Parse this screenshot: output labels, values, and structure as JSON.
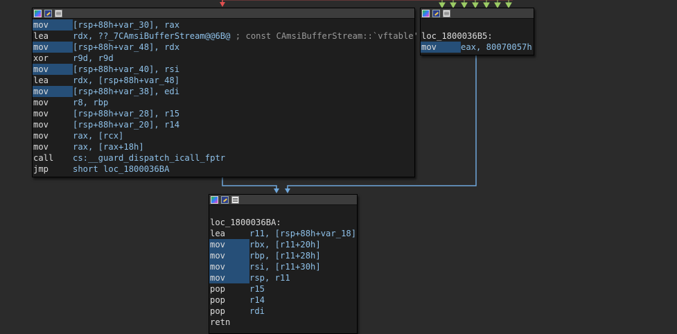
{
  "blocks": {
    "main": {
      "lines": [
        {
          "mnem": "mov",
          "ops": "[rsp+88h+var_30], rax",
          "hl": true
        },
        {
          "mnem": "lea",
          "ops": "rdx, ??_7CAmsiBufferStream@@6B@",
          "comment": " ; const CAmsiBufferStream::`vftable'",
          "hl": false
        },
        {
          "mnem": "mov",
          "ops": "[rsp+88h+var_48], rdx",
          "hl": true
        },
        {
          "mnem": "xor",
          "ops": "r9d, r9d",
          "hl": false
        },
        {
          "mnem": "mov",
          "ops": "[rsp+88h+var_40], rsi",
          "hl": true
        },
        {
          "mnem": "lea",
          "ops": "rdx, [rsp+88h+var_48]",
          "hl": false
        },
        {
          "mnem": "mov",
          "ops": "[rsp+88h+var_38], edi",
          "hl": true
        },
        {
          "mnem": "mov",
          "ops": "r8, rbp",
          "hl": false
        },
        {
          "mnem": "mov",
          "ops": "[rsp+88h+var_28], r15",
          "hl": false
        },
        {
          "mnem": "mov",
          "ops": "[rsp+88h+var_20], r14",
          "hl": false
        },
        {
          "mnem": "mov",
          "ops": "rax, [rcx]",
          "hl": false
        },
        {
          "mnem": "mov",
          "ops": "rax, [rax+18h]",
          "hl": false
        },
        {
          "mnem": "call",
          "ops": "cs:__guard_dispatch_icall_fptr",
          "hl": false
        },
        {
          "mnem": "jmp",
          "ops": "short loc_1800036BA",
          "hl": false
        }
      ]
    },
    "right": {
      "label": "loc_1800036B5:",
      "lines": [
        {
          "mnem": "mov",
          "ops": "eax, 80070057h",
          "hl": true
        }
      ]
    },
    "bottom": {
      "label": "loc_1800036BA:",
      "lines": [
        {
          "mnem": "lea",
          "ops": "r11, [rsp+88h+var_18]",
          "hl": false
        },
        {
          "mnem": "mov",
          "ops": "rbx, [r11+20h]",
          "hl": true
        },
        {
          "mnem": "mov",
          "ops": "rbp, [r11+28h]",
          "hl": true
        },
        {
          "mnem": "mov",
          "ops": "rsi, [r11+30h]",
          "hl": true
        },
        {
          "mnem": "mov",
          "ops": "rsp, r11",
          "hl": true
        },
        {
          "mnem": "pop",
          "ops": "r15",
          "hl": false
        },
        {
          "mnem": "pop",
          "ops": "r14",
          "hl": false
        },
        {
          "mnem": "pop",
          "ops": "rdi",
          "hl": false
        },
        {
          "mnem": "retn",
          "ops": "",
          "hl": false
        }
      ]
    }
  },
  "colors": {
    "background": "#2b2b2b",
    "block": "#1e1e1e",
    "edge_blue": "#6fa8dc",
    "edge_red": "#e05050",
    "edge_green": "#9ccc65",
    "highlight": "#264f78"
  }
}
